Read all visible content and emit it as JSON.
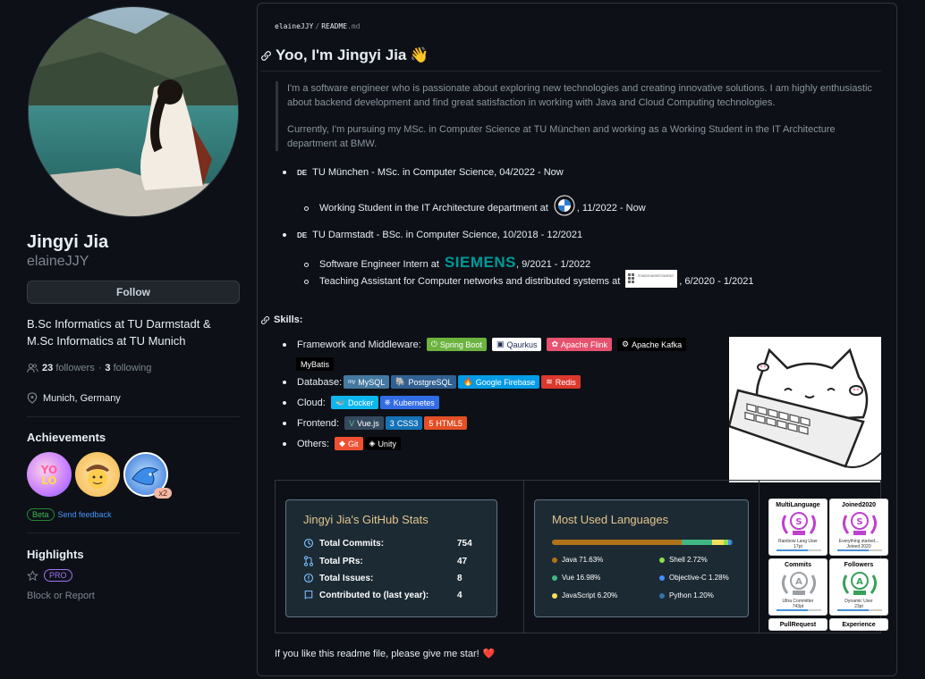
{
  "profile": {
    "name": "Jingyi Jia",
    "login": "elaineJJY",
    "follow_label": "Follow",
    "bio": "B.Sc Informatics at TU Darmstadt & M.Sc Informatics at TU Munich",
    "followers_count": "23",
    "followers_label": "followers",
    "following_count": "3",
    "following_label": "following",
    "separator": "·",
    "location": "Munich, Germany",
    "achievements_title": "Achievements",
    "achievement_badge_count": "x2",
    "beta_label": "Beta",
    "feedback_label": "Send feedback",
    "highlights_title": "Highlights",
    "pro_label": "PRO",
    "block_label": "Block or Report"
  },
  "readme": {
    "owner": "elaineJJY",
    "separator": "/",
    "file_name": "README",
    "file_ext": ".md",
    "heading": "Yoo, I'm Jingyi Jia",
    "heading_emoji": "👋",
    "intro_1": "I'm a software engineer who is passionate about exploring new technologies and creating innovative solutions. I am highly enthusiastic about backend development and find great satisfaction in working with Java and Cloud Computing technologies.",
    "intro_2": "Currently, I'm pursuing my MSc. in Computer Science at TU München and working as a Working Student in the IT Architecture department at BMW.",
    "edu_1_flag": "DE",
    "edu_1": "TU München - MSc. in Computer Science, 04/2022 - Now",
    "edu_1_sub_1_a": "Working Student in the IT Architecture department at",
    "edu_1_sub_1_b": ", 11/2022 - Now",
    "edu_2_flag": "DE",
    "edu_2": "TU Darmstadt - BSc. in Computer Science, 10/2018 - 12/2021",
    "edu_2_sub_1_a": "Software Engineer Intern at",
    "edu_2_sub_1_logo": "SIEMENS",
    "edu_2_sub_1_b": ", 9/2021 - 1/2022",
    "edu_2_sub_2_a": "Teaching Assistant for Computer networks and distributed systems at",
    "edu_2_sub_2_logo": "TECHNISCHE UNIVERSITÄT DARMSTADT",
    "edu_2_sub_2_b": ", 6/2020 - 1/2021",
    "skills_heading": "Skills:",
    "skill_labels": {
      "framework": "Framework and Middleware:",
      "database": "Database:",
      "cloud": "Cloud:",
      "frontend": "Frontend:",
      "others": "Others:"
    },
    "tags": {
      "spring": "Spring Boot",
      "quarkus": "Qaurkus",
      "flink": "Apache Flink",
      "kafka": "Apache Kafka",
      "mybatis": "MyBatis",
      "mysql": "MySQL",
      "postgres": "PostgreSQL",
      "firebase": "Google Firebase",
      "redis": "Redis",
      "docker": "Docker",
      "kubernetes": "Kubernetes",
      "vue": "Vue.js",
      "css": "CSS3",
      "html": "HTML5",
      "git": "Git",
      "unity": "Unity"
    },
    "footer": "If you like this readme file, please give me star!",
    "footer_emoji": "❤️"
  },
  "github_stats": {
    "title": "Jingyi Jia's GitHub Stats",
    "rows": [
      {
        "label": "Total Commits:",
        "value": "754"
      },
      {
        "label": "Total PRs:",
        "value": "47"
      },
      {
        "label": "Total Issues:",
        "value": "8"
      },
      {
        "label": "Contributed to (last year):",
        "value": "4"
      }
    ]
  },
  "languages": {
    "title": "Most Used Languages",
    "items": [
      {
        "label": "Java 71.63%",
        "percent": 71.63,
        "color": "#b07219"
      },
      {
        "label": "Shell 2.72%",
        "percent": 2.72,
        "color": "#89e051"
      },
      {
        "label": "Vue 16.98%",
        "percent": 16.98,
        "color": "#41b883"
      },
      {
        "label": "Objective-C 1.28%",
        "percent": 1.28,
        "color": "#438eff"
      },
      {
        "label": "JavaScript 6.20%",
        "percent": 6.2,
        "color": "#f1e05a"
      },
      {
        "label": "Python 1.20%",
        "percent": 1.2,
        "color": "#3572a5"
      }
    ]
  },
  "trophies": [
    {
      "title": "MultiLanguage",
      "sub": "Rainbow Lang User",
      "detail": "17pt",
      "letter": "S",
      "color": "#c040d0"
    },
    {
      "title": "Joined2020",
      "sub": "Everything started...",
      "detail": "Joined 2020",
      "letter": "S",
      "color": "#c040d0"
    },
    {
      "title": "Commits",
      "sub": "Ultra Committer",
      "detail": "743pt",
      "letter": "A",
      "color": "#9aa0a6"
    },
    {
      "title": "Followers",
      "sub": "Dynamic User",
      "detail": "23pt",
      "letter": "A",
      "color": "#3aa05a"
    },
    {
      "title": "PullRequest",
      "sub": "",
      "detail": "",
      "letter": "",
      "color": "#9aa0a6"
    },
    {
      "title": "Experience",
      "sub": "",
      "detail": "",
      "letter": "",
      "color": "#9aa0a6"
    }
  ]
}
